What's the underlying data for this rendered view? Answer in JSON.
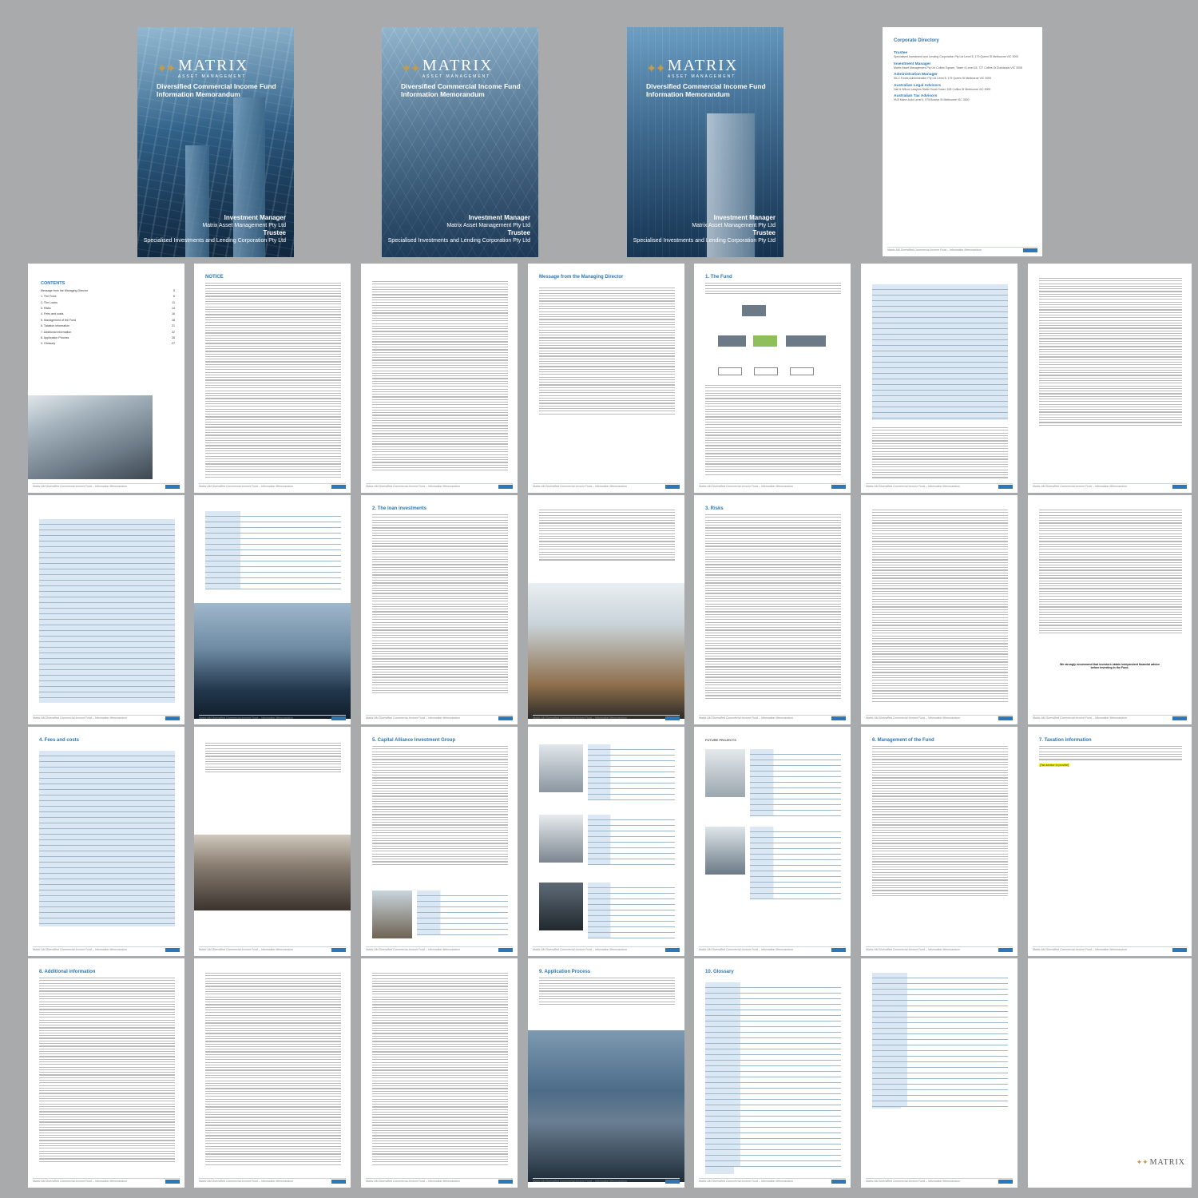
{
  "brand": {
    "logo_text": "MATRIX",
    "logo_sub": "ASSET MANAGEMENT",
    "accent": "#2b77b7",
    "gold": "#c59a4c"
  },
  "cover": {
    "title": "Diversified Commercial Income Fund Information Memorandum",
    "manager_label": "Investment Manager",
    "manager_name": "Matrix Asset Management Pty Ltd",
    "trustee_label": "Trustee",
    "trustee_name": "Specialised Investments and Lending Corporation Pty Ltd"
  },
  "directory": {
    "title": "Corporate Directory",
    "sections": [
      {
        "h": "Trustee",
        "t": "Specialised Investment and Lending Corporation Pty Ltd Level 8, 179 Queen St Melbourne VIC 3000"
      },
      {
        "h": "Investment Manager",
        "t": "Matrix Asset Management Pty Ltd Collins Square, Tower 4 Level 18, 727 Collins St Docklands VIC 3008"
      },
      {
        "h": "Administration Manager",
        "t": "SILC Funds Administration Pty Ltd Level 8, 179 Queen St Melbourne VIC 3000"
      },
      {
        "h": "Australian Legal Advisors",
        "t": "Hall & Wilcox Lawyers Rialto South Tower, 525 Collins St Melbourne VIC 3000"
      },
      {
        "h": "Australian Tax Advisors",
        "t": "HLB Mann Judd Level 9, 575 Bourke St Melbourne VIC 3000"
      }
    ]
  },
  "contents": {
    "title": "CONTENTS",
    "items": [
      {
        "l": "Message from the Managing Director",
        "p": "5"
      },
      {
        "l": "1. The Fund",
        "p": "6"
      },
      {
        "l": "2. The Loans",
        "p": "11"
      },
      {
        "l": "3. Risks",
        "p": "14"
      },
      {
        "l": "4. Fees and costs",
        "p": "16"
      },
      {
        "l": "5. Management of the Fund",
        "p": "18"
      },
      {
        "l": "6. Taxation information",
        "p": "21"
      },
      {
        "l": "7. Additional information",
        "p": "22"
      },
      {
        "l": "8. Application Process",
        "p": "26"
      },
      {
        "l": "9. Glossary",
        "p": "27"
      }
    ]
  },
  "headings": {
    "notice": "NOTICE",
    "message": "Message from the Managing Director",
    "fund": "1. The Fund",
    "loans": "2. The loan investments",
    "risks": "3. Risks",
    "fees": "4. Fees and costs",
    "capital": "5. Capital Alliance Investment Group",
    "future": "FUTURE PROJECTS",
    "management": "6. Management of the Fund",
    "tax": "7. Taxation information",
    "additional": "8. Additional information",
    "application": "9. Application Process",
    "glossary": "10. Glossary"
  },
  "callouts": {
    "advice": "We strongly recommend that investors obtain independent financial advice before investing in the Fund.",
    "tax_highlight": "[Tax advisor to provide]"
  },
  "footer_text": "Matrix AM Diversified Commercial Income Fund – Information Memorandum"
}
